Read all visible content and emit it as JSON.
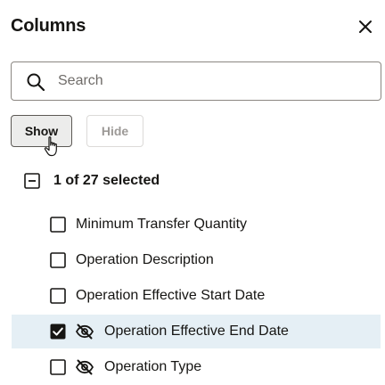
{
  "header": {
    "title": "Columns",
    "close_icon": "close-icon"
  },
  "search": {
    "placeholder": "Search",
    "value": "",
    "icon": "search-icon"
  },
  "actions": {
    "show_label": "Show",
    "hide_label": "Hide"
  },
  "summary": {
    "text": "1 of 27 selected",
    "icon": "minus-square-icon"
  },
  "columns": [
    {
      "label": "Minimum Transfer Quantity",
      "checked": false,
      "hidden": false
    },
    {
      "label": "Operation Description",
      "checked": false,
      "hidden": false
    },
    {
      "label": "Operation Effective Start Date",
      "checked": false,
      "hidden": false
    },
    {
      "label": "Operation Effective End Date",
      "checked": true,
      "hidden": true
    },
    {
      "label": "Operation Type",
      "checked": false,
      "hidden": true
    }
  ],
  "colors": {
    "selected_row": "#e5eff5",
    "text": "#161513",
    "border": "#8b8782"
  }
}
